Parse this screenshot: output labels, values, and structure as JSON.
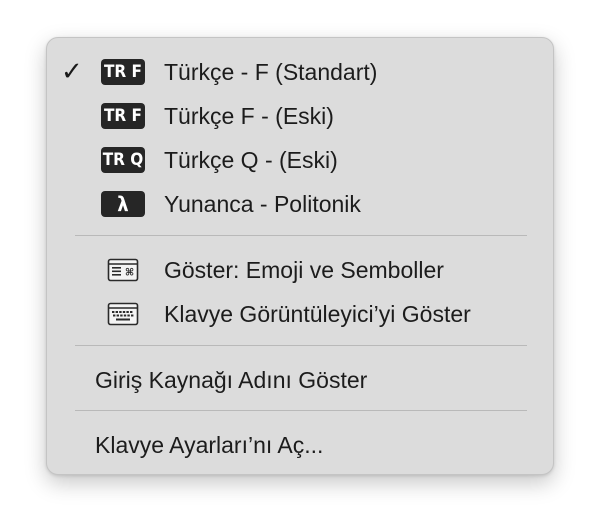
{
  "menu": {
    "input_sources": [
      {
        "badge": "TR F",
        "label": "Türkçe - F (Standart)",
        "checked": true
      },
      {
        "badge": "TR F",
        "label": "Türkçe F - (Eski)",
        "checked": false
      },
      {
        "badge": "TR Q",
        "label": "Türkçe Q - (Eski)",
        "checked": false
      },
      {
        "badge": "λ",
        "label": "Yunanca - Politonik",
        "checked": false
      }
    ],
    "check_mark": "✓",
    "viewer_items": [
      {
        "icon": "emoji-symbols-keyboard-icon",
        "label": "Göster: Emoji ve Semboller"
      },
      {
        "icon": "keyboard-viewer-icon",
        "label": "Klavye Görüntüleyici’yi Göster"
      }
    ],
    "show_input_source_name": "Giriş Kaynağı Adını Göster",
    "open_keyboard_settings": "Klavye Ayarları’nı Aç..."
  }
}
